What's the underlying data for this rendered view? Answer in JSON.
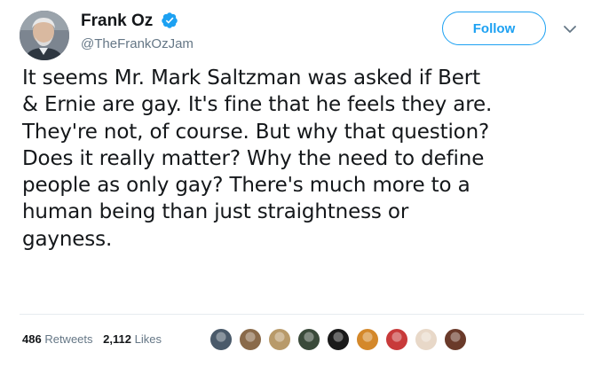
{
  "author": {
    "display_name": "Frank Oz",
    "handle": "@TheFrankOzJam",
    "verified": true
  },
  "follow_button": {
    "label": "Follow"
  },
  "tweet": {
    "lines": [
      "It seems Mr. Mark Saltzman was asked if Bert",
      "& Ernie are gay. It's fine that he feels they are.",
      "They're not, of course. But why that question?",
      "Does it really matter? Why the need to define",
      "people as only gay? There's much more to a",
      "human being than just straightness or",
      "gayness."
    ]
  },
  "stats": {
    "retweets_count": "486",
    "retweets_label": "Retweets",
    "likes_count": "2,112",
    "likes_label": "Likes"
  },
  "likers": [
    {
      "color": "#4a5a6a"
    },
    {
      "color": "#8a6a4a"
    },
    {
      "color": "#b89a6a"
    },
    {
      "color": "#3a4a3a"
    },
    {
      "color": "#1a1a1a"
    },
    {
      "color": "#d4882a"
    },
    {
      "color": "#c83a3a"
    },
    {
      "color": "#e8d8c8"
    },
    {
      "color": "#6a3a2a"
    }
  ],
  "colors": {
    "accent": "#1da1f2",
    "secondary_text": "#657786",
    "primary_text": "#14171a"
  }
}
